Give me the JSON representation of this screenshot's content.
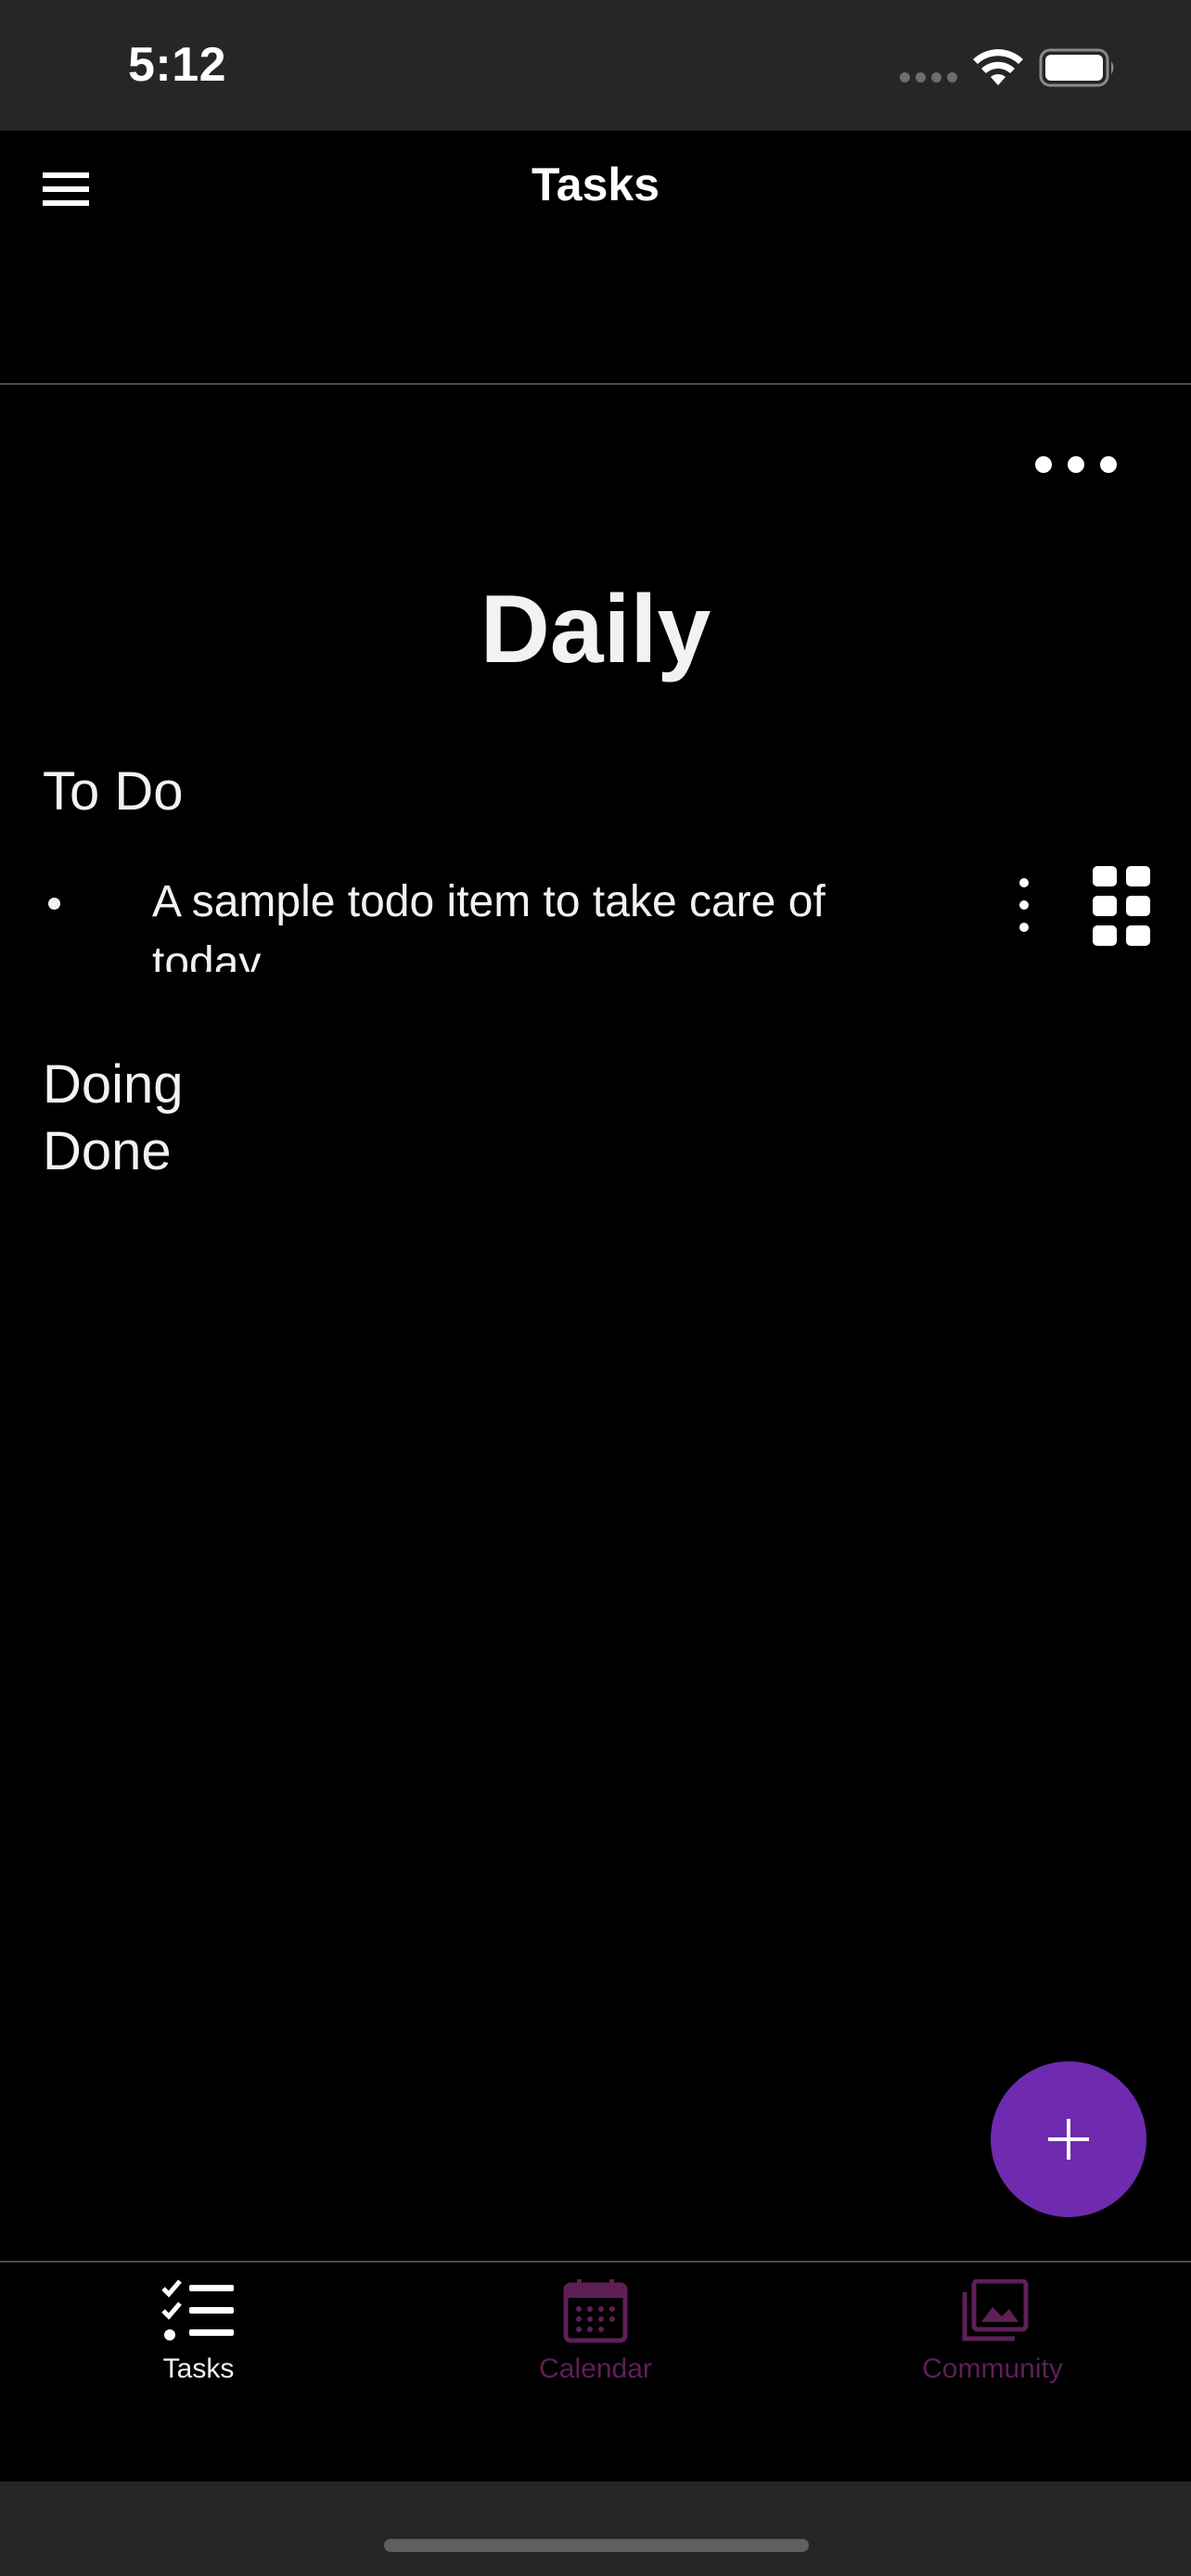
{
  "status_bar": {
    "time": "5:12",
    "icons": [
      "signal-icon",
      "wifi-icon",
      "battery-icon"
    ]
  },
  "header": {
    "title": "Tasks",
    "menu_icon": "hamburger-menu-icon"
  },
  "list": {
    "title": "Daily",
    "more_icon": "more-horizontal-icon",
    "sections": {
      "todo": {
        "label": "To Do",
        "items": [
          {
            "text": "A sample todo item to take care of today"
          }
        ]
      },
      "doing": {
        "label": "Doing"
      },
      "done": {
        "label": "Done"
      }
    }
  },
  "fab": {
    "icon": "plus-icon"
  },
  "tab_bar": {
    "tabs": [
      {
        "label": "Tasks",
        "icon": "checklist-icon",
        "active": true
      },
      {
        "label": "Calendar",
        "icon": "calendar-icon",
        "active": false
      },
      {
        "label": "Community",
        "icon": "photo-library-icon",
        "active": false
      }
    ]
  },
  "colors": {
    "background": "#000000",
    "system_bar": "#262626",
    "accent": "#6f2bb0",
    "inactive_tab": "#5e1f56",
    "text": "#f2f2f2",
    "divider": "#4a4a4a"
  }
}
